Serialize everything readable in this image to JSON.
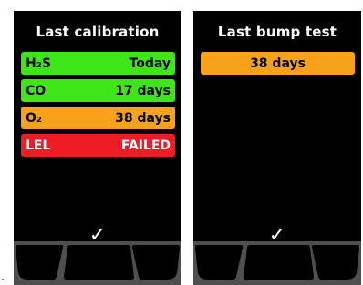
{
  "calibration": {
    "title": "Last calibration",
    "rows": [
      {
        "gas": "H₂S",
        "value": "Today",
        "status_color": "#3ee619",
        "text_color": "#000000"
      },
      {
        "gas": "CO",
        "value": "17 days",
        "status_color": "#3ee619",
        "text_color": "#000000"
      },
      {
        "gas": "O₂",
        "value": "38 days",
        "status_color": "#f7a21b",
        "text_color": "#000000"
      },
      {
        "gas": "LEL",
        "value": "FAILED",
        "status_color": "#ee1c24",
        "text_color": "#ffffff"
      }
    ],
    "confirm_icon": "check-icon",
    "confirm_glyph": "✓"
  },
  "bump_test": {
    "title": "Last bump test",
    "rows": [
      {
        "value": "38 days",
        "status_color": "#f7a21b",
        "text_color": "#000000"
      }
    ],
    "confirm_icon": "check-icon",
    "confirm_glyph": "✓"
  }
}
